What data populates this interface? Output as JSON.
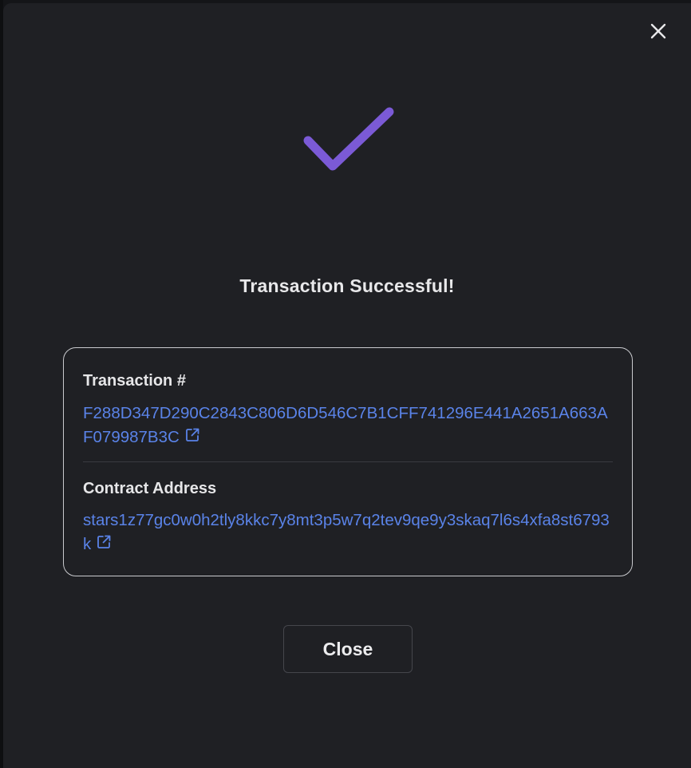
{
  "modal": {
    "title": "Transaction Successful!",
    "close_icon": "close-icon",
    "status_icon": "checkmark-icon",
    "accent_color": "#7b5ad6",
    "link_color": "#5a83e8"
  },
  "details": {
    "transaction": {
      "label": "Transaction #",
      "value": "F288D347D290C2843C806D6D546C7B1CFF741296E441A2651A663AF079987B3C",
      "icon": "external-link-icon"
    },
    "contract": {
      "label": "Contract Address",
      "value": "stars1z77gc0w0h2tly8kkc7y8mt3p5w7q2tev9qe9y3skaq7l6s4xfa8st6793k",
      "icon": "external-link-icon"
    }
  },
  "footer": {
    "close_label": "Close"
  }
}
